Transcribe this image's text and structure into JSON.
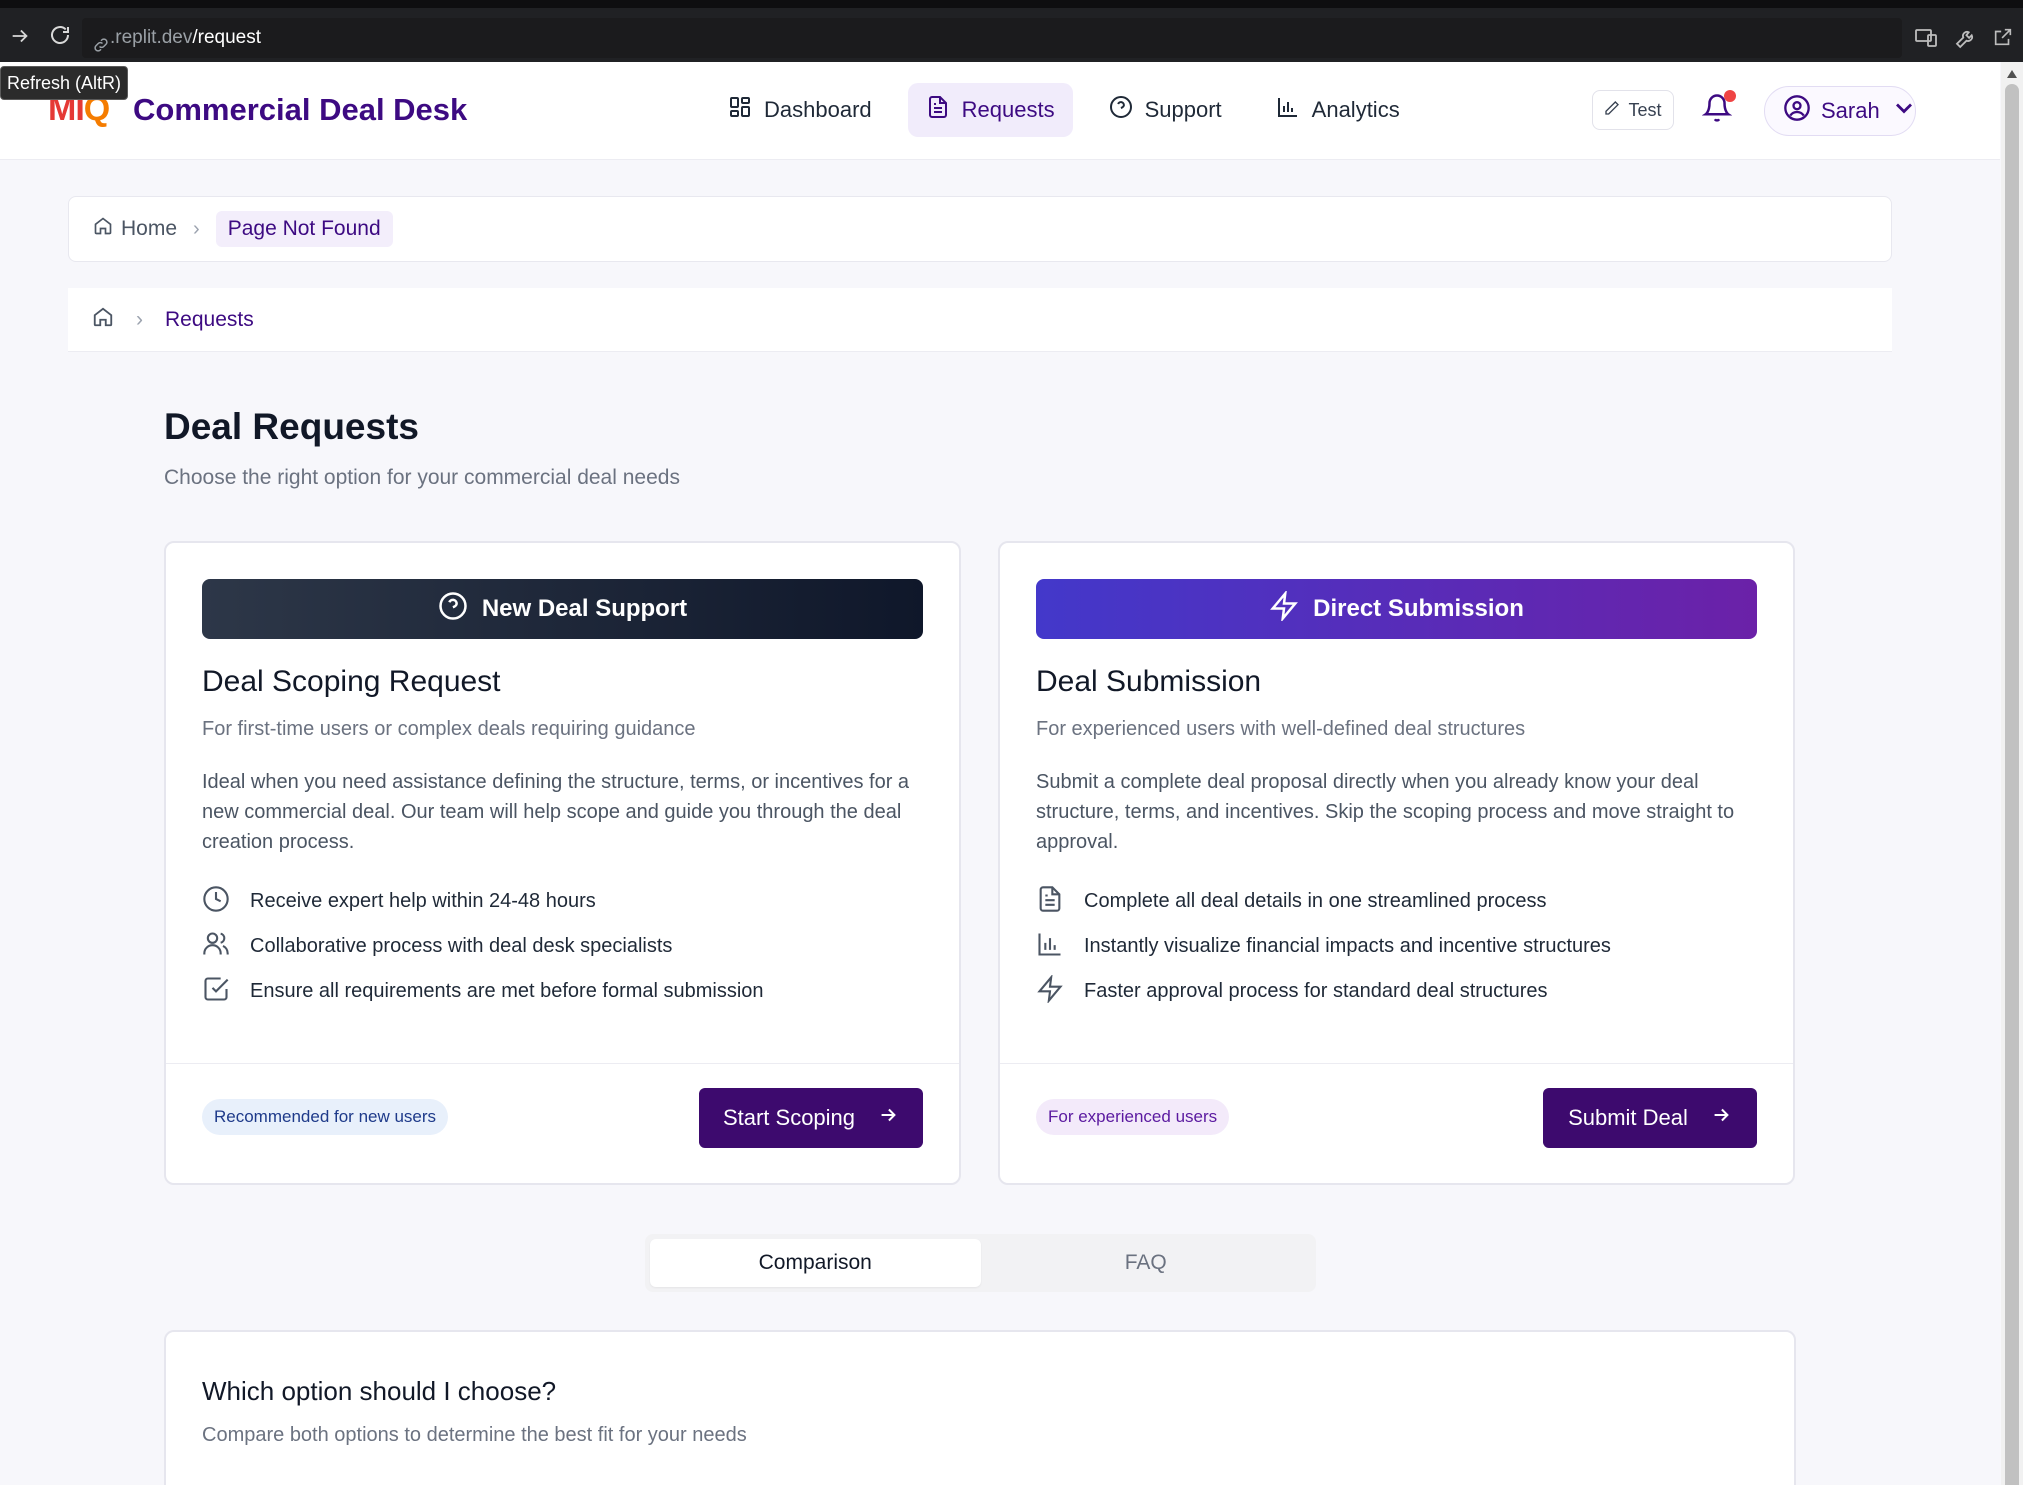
{
  "browser": {
    "url_host": ".replit.dev",
    "url_path": "/request",
    "tooltip": "Refresh (AltR)"
  },
  "header": {
    "logo_part1": "MI",
    "logo_part2": "Q",
    "brand": "Commercial Deal Desk",
    "nav": [
      {
        "label": "Dashboard",
        "icon": "dashboard-grid-icon"
      },
      {
        "label": "Requests",
        "icon": "document-icon",
        "active": true
      },
      {
        "label": "Support",
        "icon": "help-circle-icon"
      },
      {
        "label": "Analytics",
        "icon": "bar-chart-icon"
      }
    ],
    "test_label": "Test",
    "user_name": "Sarah"
  },
  "breadcrumb_top": {
    "home": "Home",
    "current": "Page Not Found"
  },
  "breadcrumb_inner": {
    "current": "Requests"
  },
  "page": {
    "title": "Deal Requests",
    "subtitle": "Choose the right option for your commercial deal needs"
  },
  "cards": {
    "scoping": {
      "banner": "New Deal Support",
      "title": "Deal Scoping Request",
      "subtitle": "For first-time users or complex deals requiring guidance",
      "description": "Ideal when you need assistance defining the structure, terms, or incentives for a new commercial deal. Our team will help scope and guide you through the deal creation process.",
      "features": [
        {
          "text": "Receive expert help within 24-48 hours",
          "icon": "clock-icon"
        },
        {
          "text": "Collaborative process with deal desk specialists",
          "icon": "users-icon"
        },
        {
          "text": "Ensure all requirements are met before formal submission",
          "icon": "checkbox-icon"
        }
      ],
      "badge": "Recommended for new users",
      "cta": "Start Scoping"
    },
    "submission": {
      "banner": "Direct Submission",
      "title": "Deal Submission",
      "subtitle": "For experienced users with well-defined deal structures",
      "description": "Submit a complete deal proposal directly when you already know your deal structure, terms, and incentives. Skip the scoping process and move straight to approval.",
      "features": [
        {
          "text": "Complete all deal details in one streamlined process",
          "icon": "document-icon"
        },
        {
          "text": "Instantly visualize financial impacts and incentive structures",
          "icon": "bar-chart-icon"
        },
        {
          "text": "Faster approval process for standard deal structures",
          "icon": "lightning-icon"
        }
      ],
      "badge": "For experienced users",
      "cta": "Submit Deal"
    }
  },
  "tabs": [
    "Comparison",
    "FAQ"
  ],
  "comparison": {
    "title": "Which option should I choose?",
    "subtitle": "Compare both options to determine the best fit for your needs"
  },
  "colors": {
    "brand": "#3d0a82",
    "cta": "#3d0a6e",
    "notification_dot": "#ef4444"
  }
}
